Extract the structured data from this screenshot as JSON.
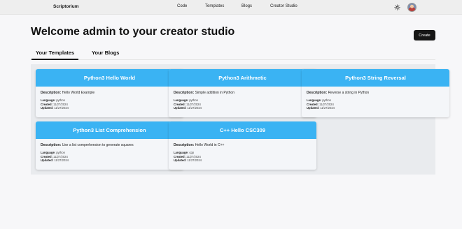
{
  "nav": {
    "brand": "Scriptorium",
    "links": [
      "Code",
      "Templates",
      "Blogs",
      "Creator Studio"
    ]
  },
  "page": {
    "title": "Welcome admin to your creator studio",
    "create_label": "Create"
  },
  "tabs": [
    "Your Templates",
    "Your Blogs"
  ],
  "labels": {
    "description": "Description:",
    "language": "Language:",
    "created": "Created:",
    "updated": "Updated:"
  },
  "cards": [
    {
      "title": "Python3 Hello World",
      "description": "Hello World Example",
      "language": "python",
      "created": "11/27/2024",
      "updated": "11/27/2024"
    },
    {
      "title": "Python3 Arithmetic",
      "description": "Simple addition in Python",
      "language": "python",
      "created": "11/27/2024",
      "updated": "11/27/2024"
    },
    {
      "title": "Python3 String Reversal",
      "description": "Reverse a string in Python",
      "language": "python",
      "created": "11/27/2024",
      "updated": "11/27/2024"
    },
    {
      "title": "Python3 List Comprehension",
      "description": "Use a list comprehension to generate squares",
      "language": "python",
      "created": "11/27/2024",
      "updated": "11/27/2024"
    },
    {
      "title": "C++ Hello CSC309",
      "description": "Hello World in C++",
      "language": "cpp",
      "created": "11/27/2024",
      "updated": "11/27/2024"
    }
  ],
  "colors": {
    "card_header": "#3ab3f3",
    "create_button": "#161616"
  },
  "icons": {
    "theme_toggle": "sun-icon",
    "avatar": "avatar"
  }
}
